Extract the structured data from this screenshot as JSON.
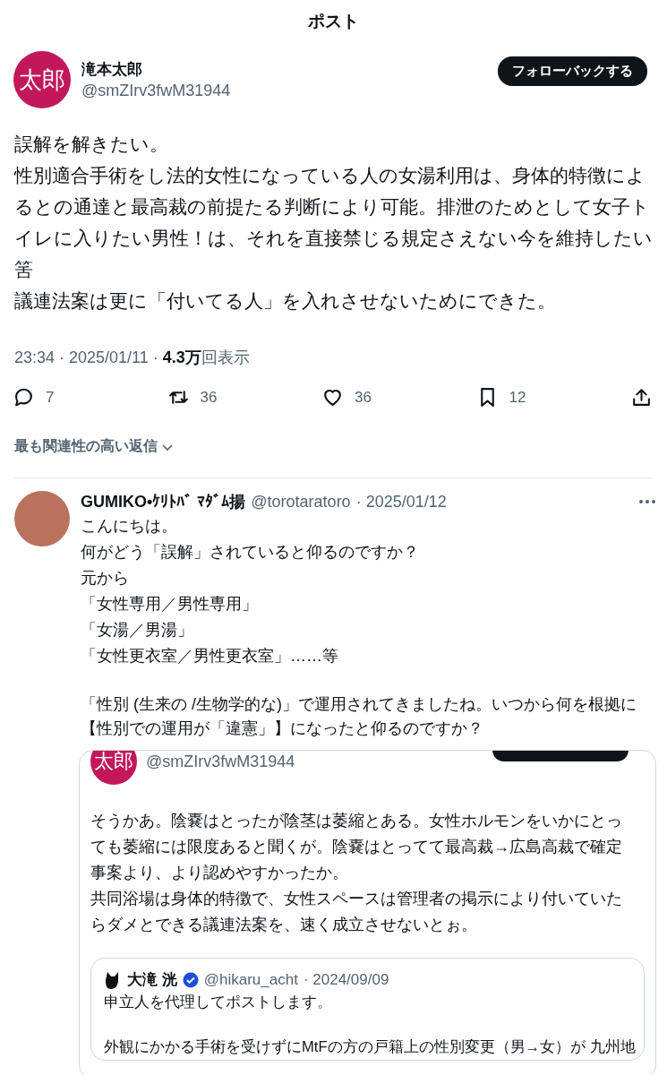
{
  "header": {
    "title": "ポスト"
  },
  "post": {
    "author": {
      "avatar_text": "太郎",
      "name": "滝本太郎",
      "handle": "@smZIrv3fwM31944"
    },
    "follow_button": "フォローバックする",
    "text": [
      "誤解を解きたい。",
      "性別適合手術をし法的女性になっている人の女湯利用は、身体的特徴によるとの通達と最高裁の前提たる判断により可能。排泄のためとして女子トイレに入りたい男性！は、それを直接禁じる規定さえない今を維持したい筈",
      "議連法案は更に「付いてる人」を入れさせないためにできた。"
    ],
    "meta": "23:34 · 2025/01/11 · **4.3万**回表示",
    "actions": [
      {
        "kind": "reply",
        "count": "7"
      },
      {
        "kind": "repost",
        "count": "36"
      },
      {
        "kind": "like",
        "count": "36"
      },
      {
        "kind": "bookmark",
        "count": "12"
      },
      {
        "kind": "share"
      }
    ]
  },
  "replies_sort": "最も関連性の高い返信",
  "reply": {
    "name": "GUMIKO•ｹﾘﾄﾊﾞ ﾏﾀﾞﾑ揚",
    "handle": "@torotaratoro",
    "date": "· 2025/01/12",
    "paragraphs": [
      [
        "こんにちは。",
        "何がどう「誤解」されていると仰るのですか？",
        "元から",
        "「女性専用／男性専用」",
        "「女湯／男湯」",
        "「女性更衣室／男性更衣室」……等"
      ],
      [
        "「性別 (生来の /生物学的な)」で運用されてきましたね。いつから何を根拠に【性別での運用が「違憲」】になったと仰るのですか？"
      ]
    ],
    "quote": {
      "avatar_text": "太郎",
      "handle": "@smZIrv3fwM31944",
      "text": [
        "そうかあ。陰嚢はとったが陰茎は萎縮とある。女性ホルモンをいかにとっても萎縮には限度あると聞くが。陰嚢はとってて最高裁→広島高裁で確定事案より、より認めやすかったか。",
        "共同浴場は身体的特徴で、女性スペースは管理者の掲示により付いていたらダメとできる議連法案を、速く成立させないとぉ。"
      ],
      "quote": {
        "name": "大滝 洸",
        "verified": true,
        "handle": "@hikaru_acht",
        "date": "· 2024/09/09",
        "paragraphs": [
          "申立人を代理してポストします。",
          "外観にかかる手術を受けずにMtFの方の戸籍上の性別変更（男→女）が 九州地"
        ]
      }
    }
  }
}
